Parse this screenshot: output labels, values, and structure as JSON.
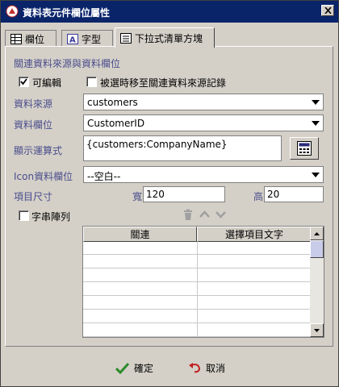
{
  "window": {
    "title": "資料表元件欄位屬性"
  },
  "tabs": [
    {
      "label": "欄位",
      "icon": "grid-icon"
    },
    {
      "label": "字型",
      "icon": "font-icon"
    },
    {
      "label": "下拉式清單方塊",
      "icon": "list-icon"
    }
  ],
  "form": {
    "section_title": "關連資料來源與資料欄位",
    "editable_label": "可編輯",
    "editable_checked": true,
    "move_record_label": "被選時移至關連資料來源記錄",
    "move_record_checked": false,
    "datasource_label": "資料來源",
    "datasource_value": "customers",
    "datafield_label": "資料欄位",
    "datafield_value": "CustomerID",
    "display_expr_label": "顯示運算式",
    "display_expr_value": "{customers:CompanyName}",
    "icon_field_label": "Icon資料欄位",
    "icon_field_value": "--空白--",
    "item_size_label": "項目尺寸",
    "width_label": "寬",
    "width_value": "120",
    "height_label": "高",
    "height_value": "20",
    "string_array_label": "字串陣列",
    "string_array_checked": false
  },
  "table": {
    "columns": [
      "關連",
      "選擇項目文字"
    ],
    "rows": [
      [
        "",
        ""
      ],
      [
        "",
        ""
      ],
      [
        "",
        ""
      ],
      [
        "",
        ""
      ],
      [
        "",
        ""
      ],
      [
        "",
        ""
      ],
      [
        "",
        ""
      ]
    ]
  },
  "footer": {
    "ok_label": "確定",
    "cancel_label": "取消"
  },
  "colors": {
    "titlebar": "#0a246a",
    "label_blue": "#4a4d8c",
    "window_bg": "#d4d0c8"
  }
}
